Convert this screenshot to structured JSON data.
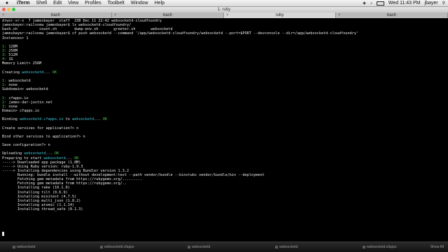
{
  "menubar": {
    "apple": "",
    "items": [
      "iTerm",
      "Shell",
      "Edit",
      "View",
      "Profiles",
      "Toolbelt",
      "Window",
      "Help"
    ],
    "clock": "Wed 11:43 PM",
    "user": "jbayer"
  },
  "window": {
    "title": "1. ruby"
  },
  "tabs": [
    {
      "label": "bash"
    },
    {
      "label": "bash"
    },
    {
      "label": "ruby"
    },
    {
      "label": "bash"
    }
  ],
  "terminal": {
    "colors": {
      "fg": "#e8e8e8",
      "cyan": "#3fc7d8",
      "green": "#4ec94e"
    },
    "lines": [
      [
        {
          "t": "drwxr-xr-x  7 jamesbayer  staff  238 Dec 11 22:42 websocketd-cloudfoundry"
        }
      ],
      [
        {
          "t": "jamesbayer:railsnew jamesbayer$ ls websocketd-cloudfoundry/"
        }
      ],
      [
        {
          "t": "bash.sh          count.sh        dump-env.sh       greeter.sh       websocketd"
        }
      ],
      [
        {
          "t": "jamesbayer:railsnew jamesbayer$ cf push websocketd --command '/app/websocketd-cloudfoundry/websocketd --port=$PORT --devconsole --dir=/app/websocketd-cloudfoundry'"
        }
      ],
      [
        {
          "t": "Instances> 1"
        }
      ],
      [
        {
          "t": ""
        }
      ],
      [
        {
          "t": "1: ",
          "c": "green"
        },
        {
          "t": "128M"
        }
      ],
      [
        {
          "t": "2: ",
          "c": "green"
        },
        {
          "t": "256M"
        }
      ],
      [
        {
          "t": "3: ",
          "c": "green"
        },
        {
          "t": "512M"
        }
      ],
      [
        {
          "t": "4: ",
          "c": "green"
        },
        {
          "t": "1G"
        }
      ],
      [
        {
          "t": "Memory Limit> 256M"
        }
      ],
      [
        {
          "t": ""
        }
      ],
      [
        {
          "t": "Creating "
        },
        {
          "t": "websocketd",
          "c": "cyan"
        },
        {
          "t": "... "
        },
        {
          "t": "OK",
          "c": "green"
        }
      ],
      [
        {
          "t": ""
        }
      ],
      [
        {
          "t": "1: ",
          "c": "green"
        },
        {
          "t": "websocketd"
        }
      ],
      [
        {
          "t": "2: ",
          "c": "green"
        },
        {
          "t": "none"
        }
      ],
      [
        {
          "t": "Subdomain> websocketd"
        }
      ],
      [
        {
          "t": ""
        }
      ],
      [
        {
          "t": "1: ",
          "c": "green"
        },
        {
          "t": "cfapps.io"
        }
      ],
      [
        {
          "t": "2: ",
          "c": "green"
        },
        {
          "t": "james-dar-justin.net"
        }
      ],
      [
        {
          "t": "3: ",
          "c": "green"
        },
        {
          "t": "none"
        }
      ],
      [
        {
          "t": "Domain> cfapps.io"
        }
      ],
      [
        {
          "t": ""
        }
      ],
      [
        {
          "t": "Binding "
        },
        {
          "t": "websocketd.cfapps.io",
          "c": "cyan"
        },
        {
          "t": " to "
        },
        {
          "t": "websocketd",
          "c": "cyan"
        },
        {
          "t": "... "
        },
        {
          "t": "OK",
          "c": "green"
        }
      ],
      [
        {
          "t": ""
        }
      ],
      [
        {
          "t": "Create services for application?> n"
        }
      ],
      [
        {
          "t": ""
        }
      ],
      [
        {
          "t": "Bind other services to application?> n"
        }
      ],
      [
        {
          "t": ""
        }
      ],
      [
        {
          "t": "Save configuration?> n"
        }
      ],
      [
        {
          "t": ""
        }
      ],
      [
        {
          "t": "Uploading "
        },
        {
          "t": "websocketd",
          "c": "cyan"
        },
        {
          "t": "... "
        },
        {
          "t": "OK",
          "c": "green"
        }
      ],
      [
        {
          "t": "Preparing to start "
        },
        {
          "t": "websocketd",
          "c": "cyan"
        },
        {
          "t": "... "
        },
        {
          "t": "OK",
          "c": "green"
        }
      ],
      [
        {
          "t": "-----> Downloaded app package (1.0M)"
        }
      ],
      [
        {
          "t": "-----> Using Ruby version: ruby-1.9.3"
        }
      ],
      [
        {
          "t": "-----> Installing dependencies using Bundler version 1.3.2"
        }
      ],
      [
        {
          "t": "       Running: bundle install --without development:test --path vendor/bundle --binstubs vendor/bundle/bin --deployment"
        }
      ],
      [
        {
          "t": "       Fetching gem metadata from https://rubygems.org/........."
        }
      ],
      [
        {
          "t": "       Fetching gem metadata from https://rubygems.org/.."
        }
      ],
      [
        {
          "t": "       Installing rake (10.1.0)"
        }
      ],
      [
        {
          "t": "       Installing tilt (0.6.9)"
        }
      ],
      [
        {
          "t": "       Installing minitest (4.7.5)"
        }
      ],
      [
        {
          "t": "       Installing multi_json (1.8.2)"
        }
      ],
      [
        {
          "t": "       Installing atomic (1.1.14)"
        }
      ],
      [
        {
          "t": "       Installing thread_safe (0.1.3)"
        }
      ],
      [
        {
          "t": ""
        }
      ]
    ]
  },
  "dock": {
    "items": [
      "websocketd",
      "websocketd.cfapps",
      "websocketd",
      "websocketd",
      "websocketd.cfapps"
    ],
    "show_all": "Show All"
  }
}
